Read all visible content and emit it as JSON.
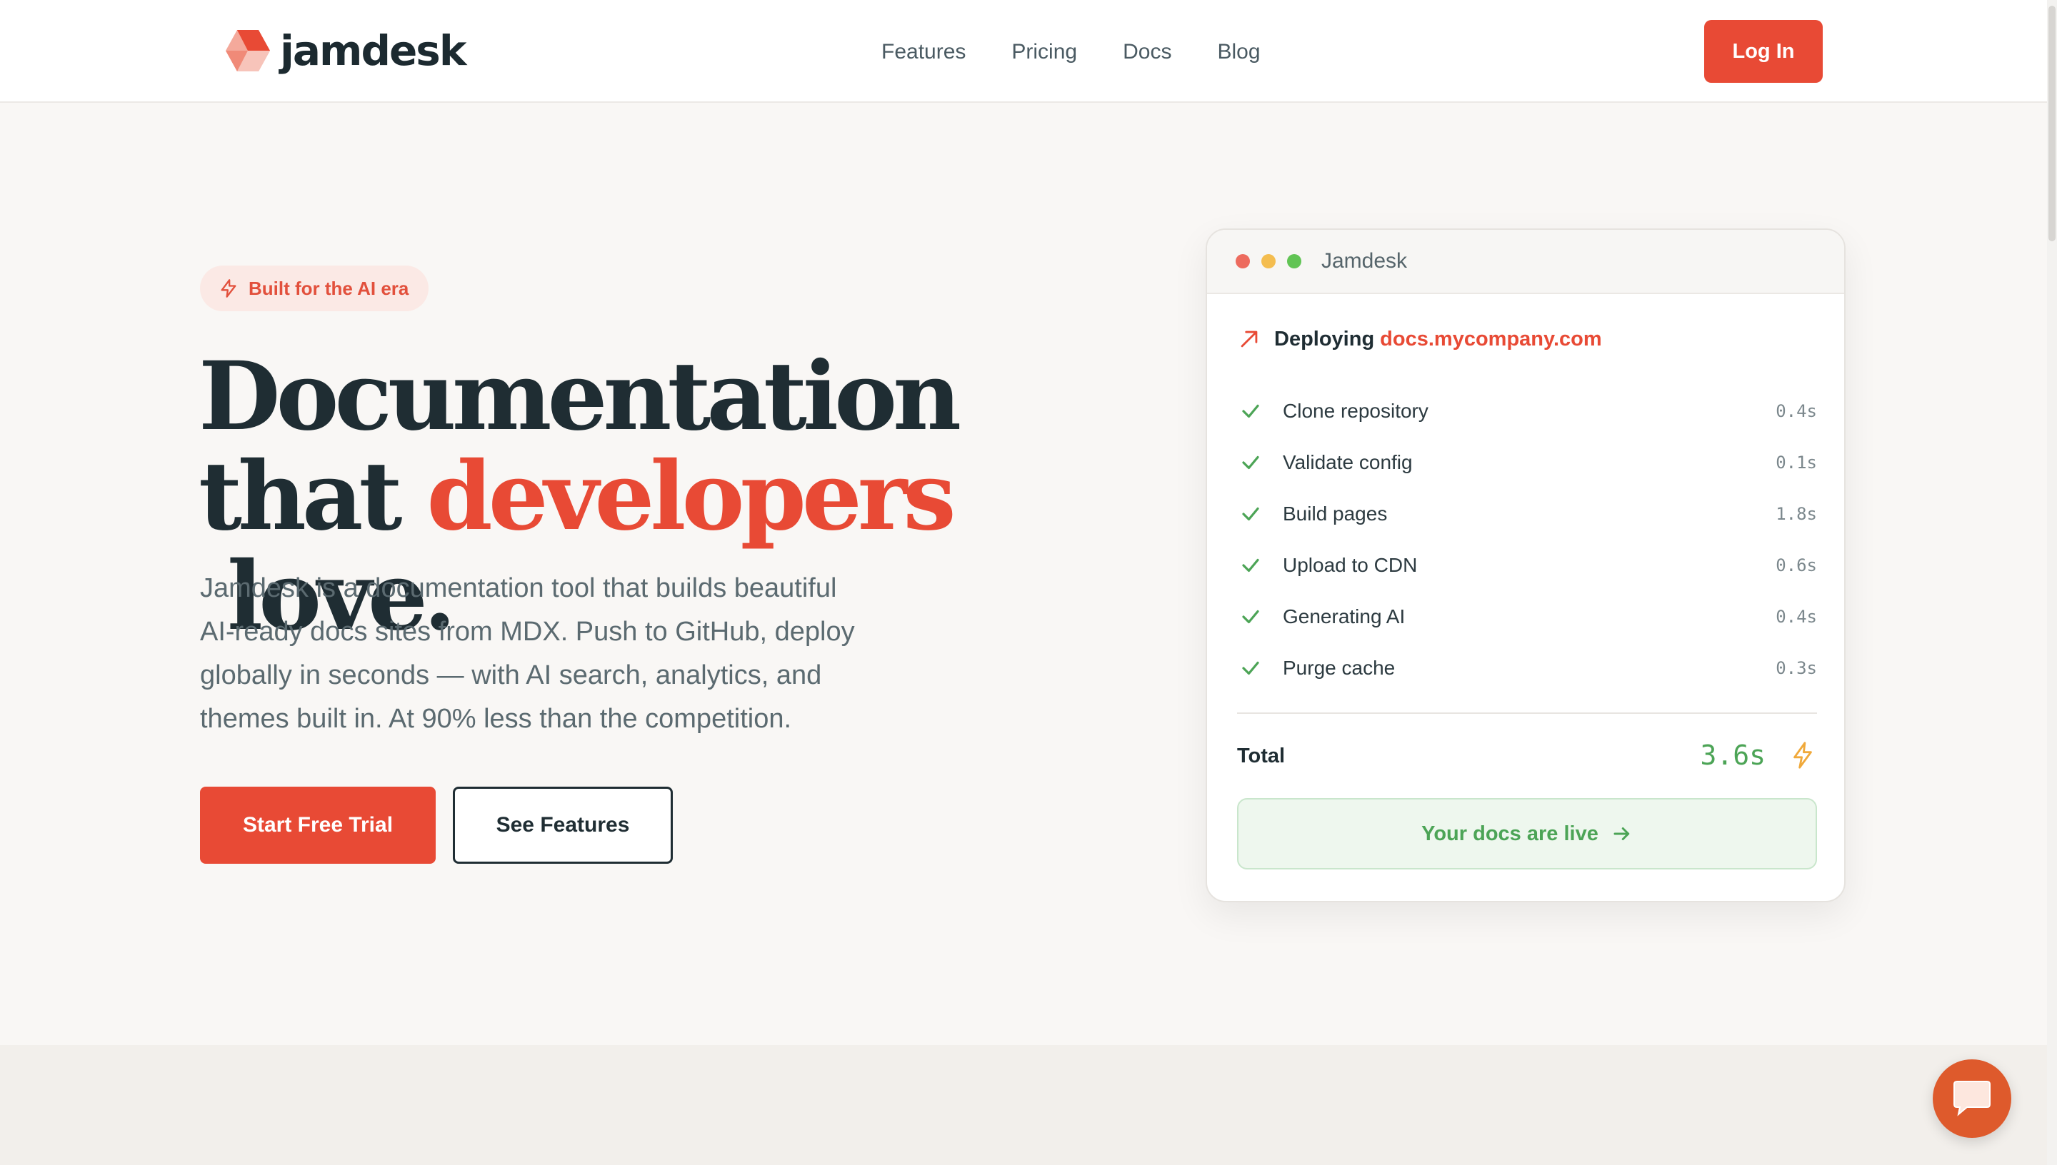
{
  "nav": {
    "logo_text": "jamdesk",
    "links": [
      "Features",
      "Pricing",
      "Docs",
      "Blog"
    ],
    "login_label": "Log In"
  },
  "hero": {
    "badge": "Built for the AI era",
    "headline_line1": "Documentation",
    "headline_that": "that ",
    "headline_accent": "developers",
    "headline_end": " love.",
    "subtext": "Jamdesk is a documentation tool that builds beautiful AI-ready docs sites from MDX. Push to GitHub, deploy globally in seconds — with AI search, analytics, and themes built in. At 90% less than the competition.",
    "primary_cta": "Start Free Trial",
    "secondary_cta": "See Features"
  },
  "card": {
    "window_title": "Jamdesk",
    "deploying_label": "Deploying",
    "domain": "docs.mycompany.com",
    "steps": [
      {
        "label": "Clone repository",
        "time": "0.4s"
      },
      {
        "label": "Validate config",
        "time": "0.1s"
      },
      {
        "label": "Build pages",
        "time": "1.8s"
      },
      {
        "label": "Upload to CDN",
        "time": "0.6s"
      },
      {
        "label": "Generating AI",
        "time": "0.4s"
      },
      {
        "label": "Purge cache",
        "time": "0.3s"
      }
    ],
    "total_label": "Total",
    "total_value": "3.6s",
    "live_label": "Your docs are live"
  },
  "colors": {
    "brand": "#e84a35",
    "success": "#4ca456",
    "text_dark": "#1f2d33",
    "chat": "#de5a2c"
  },
  "icons": {
    "logo": "hexagon-logo-icon",
    "badge": "lightning-icon",
    "deploy": "arrow-up-right-icon",
    "step": "check-icon",
    "total": "lightning-icon",
    "live": "arrow-right-icon",
    "chat": "chat-bubble-icon"
  }
}
